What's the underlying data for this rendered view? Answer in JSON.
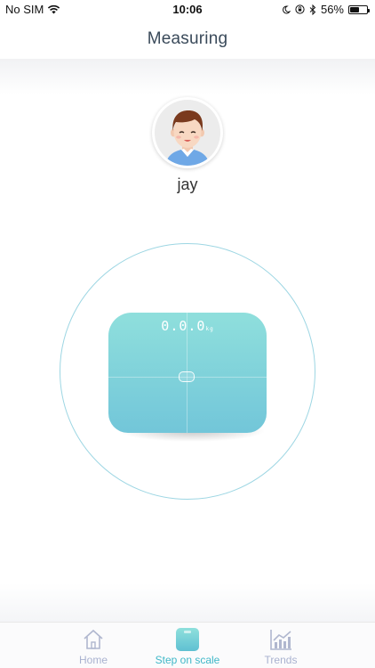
{
  "status_bar": {
    "carrier": "No SIM",
    "time": "10:06",
    "battery_percent": "56%",
    "battery_level": 0.56,
    "icons": [
      "wifi-icon",
      "moon-icon",
      "orientation-lock-icon",
      "bluetooth-icon",
      "battery-icon"
    ]
  },
  "header": {
    "title": "Measuring"
  },
  "user": {
    "name": "jay"
  },
  "scale": {
    "display": "0.0.0",
    "unit": "kg"
  },
  "tabs": [
    {
      "label": "Home",
      "icon": "home-icon",
      "active": false
    },
    {
      "label": "Step on scale",
      "icon": "scale-icon",
      "active": true
    },
    {
      "label": "Trends",
      "icon": "trends-icon",
      "active": false
    }
  ],
  "colors": {
    "active_tab": "#3fb8c8",
    "inactive_tab": "#a9b2d0",
    "ring": "#9dd6e3",
    "scale_top": "#8fdfdc",
    "scale_bottom": "#72c6d9"
  }
}
